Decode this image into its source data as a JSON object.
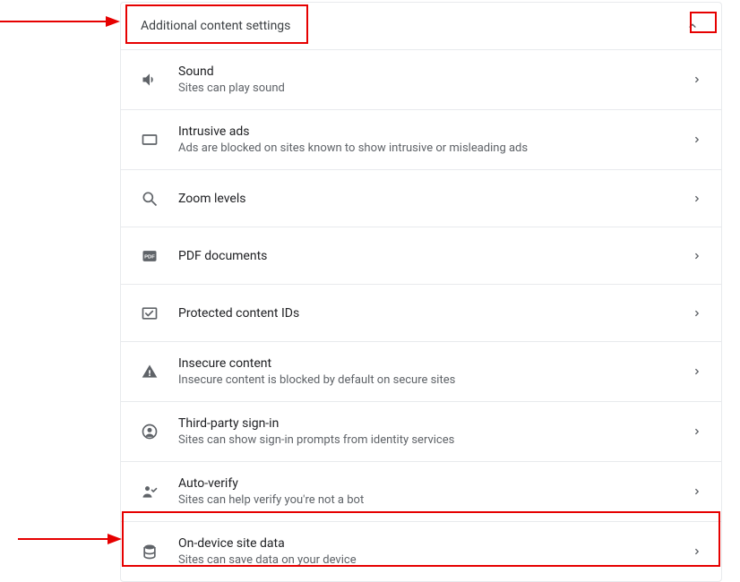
{
  "header": {
    "title": "Additional content settings"
  },
  "items": [
    {
      "id": "sound",
      "title": "Sound",
      "sub": "Sites can play sound"
    },
    {
      "id": "intrusive-ads",
      "title": "Intrusive ads",
      "sub": "Ads are blocked on sites known to show intrusive or misleading ads"
    },
    {
      "id": "zoom-levels",
      "title": "Zoom levels",
      "sub": ""
    },
    {
      "id": "pdf-documents",
      "title": "PDF documents",
      "sub": ""
    },
    {
      "id": "protected-content-ids",
      "title": "Protected content IDs",
      "sub": ""
    },
    {
      "id": "insecure-content",
      "title": "Insecure content",
      "sub": "Insecure content is blocked by default on secure sites"
    },
    {
      "id": "third-party-sign-in",
      "title": "Third-party sign-in",
      "sub": "Sites can show sign-in prompts from identity services"
    },
    {
      "id": "auto-verify",
      "title": "Auto-verify",
      "sub": "Sites can help verify you're not a bot"
    },
    {
      "id": "on-device-site-data",
      "title": "On-device site data",
      "sub": "Sites can save data on your device"
    }
  ]
}
